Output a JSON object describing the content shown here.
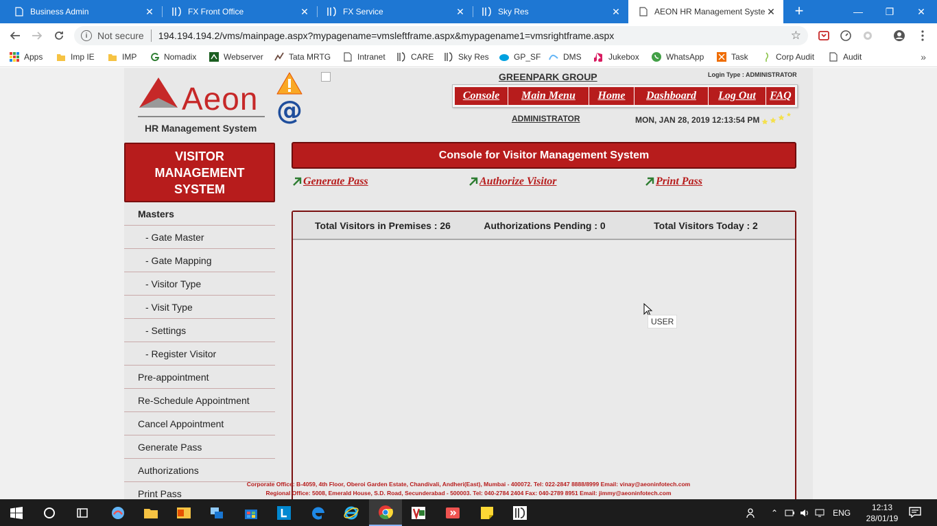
{
  "browser": {
    "tabs": [
      {
        "title": "Business Admin",
        "icon": "page-icon",
        "active": false
      },
      {
        "title": "FX Front Office",
        "icon": "ids-icon",
        "active": false
      },
      {
        "title": "FX Service",
        "icon": "ids-icon",
        "active": false
      },
      {
        "title": "Sky Res",
        "icon": "ids-icon",
        "active": false
      },
      {
        "title": "AEON HR Management System",
        "icon": "page-icon",
        "active": true
      }
    ],
    "close_glyph": "✕",
    "new_tab": "+",
    "window_controls": {
      "minimize": "—",
      "restore": "❐",
      "close": "✕"
    },
    "security_label": "Not secure",
    "url": "194.194.194.2/vms/mainpage.aspx?mypagename=vmsleftframe.aspx&mypagename1=vmsrightframe.aspx",
    "bookmarks": [
      {
        "label": "Apps",
        "icon": "apps-grid-icon"
      },
      {
        "label": "Imp IE",
        "icon": "folder-icon"
      },
      {
        "label": "IMP",
        "icon": "folder-icon"
      },
      {
        "label": "Nomadix",
        "icon": "nomadix-icon"
      },
      {
        "label": "Webserver",
        "icon": "webserver-icon"
      },
      {
        "label": "Tata MRTG",
        "icon": "mrtg-icon"
      },
      {
        "label": "Intranet",
        "icon": "page-icon"
      },
      {
        "label": "CARE",
        "icon": "ids-icon"
      },
      {
        "label": "Sky Res",
        "icon": "ids-icon"
      },
      {
        "label": "GP_SF",
        "icon": "salesforce-icon"
      },
      {
        "label": "DMS",
        "icon": "dms-icon"
      },
      {
        "label": "Jukebox",
        "icon": "jukebox-icon"
      },
      {
        "label": "WhatsApp",
        "icon": "whatsapp-icon"
      },
      {
        "label": "Task",
        "icon": "task-icon"
      },
      {
        "label": "Corp Audit",
        "icon": "corp-audit-icon"
      },
      {
        "label": "Audit",
        "icon": "page-icon"
      }
    ],
    "more_bookmarks": "»"
  },
  "app": {
    "logo_text": "Aeon",
    "logo_subtitle": "HR Management System",
    "company": "GREENPARK GROUP",
    "login_type": "Login Type : ADMINISTRATOR",
    "user": "ADMINISTRATOR",
    "datetime": "MON, JAN 28, 2019 12:13:54 PM",
    "menu": [
      "Console",
      "Main Menu",
      "Home",
      "Dashboard",
      "Log Out",
      "FAQ"
    ],
    "module_title_lines": [
      "VISITOR",
      "MANAGEMENT",
      "SYSTEM"
    ],
    "sidebar": [
      {
        "label": "Masters",
        "level": "head"
      },
      {
        "label": "- Gate Master",
        "level": "sub"
      },
      {
        "label": "- Gate Mapping",
        "level": "sub"
      },
      {
        "label": "- Visitor Type",
        "level": "sub"
      },
      {
        "label": "- Visit Type",
        "level": "sub"
      },
      {
        "label": "- Settings",
        "level": "sub"
      },
      {
        "label": "- Register Visitor",
        "level": "sub"
      },
      {
        "label": "Pre-appointment",
        "level": "top"
      },
      {
        "label": "Re-Schedule Appointment",
        "level": "top"
      },
      {
        "label": "Cancel Appointment",
        "level": "top"
      },
      {
        "label": "Generate Pass",
        "level": "top"
      },
      {
        "label": "Authorizations",
        "level": "top"
      },
      {
        "label": "Print Pass",
        "level": "top"
      }
    ],
    "console_title": "Console for Visitor Management System",
    "quick_links": [
      "Generate Pass",
      "Authorize Visitor",
      "Print Pass"
    ],
    "stats": [
      "Total Visitors in Premises : 26",
      "Authorizations Pending : 0",
      "Total Visitors Today : 2"
    ],
    "tooltip": "USER",
    "footer_lines": [
      "Corporate Office: B-4059, 4th Floor, Oberoi Garden Estate, Chandivali, Andheri(East), Mumbai - 400072. Tel: 022-2847 8888/8999 Email: vinay@aeoninfotech.com",
      "Regional Office: 5008, Emerald House, S.D. Road, Secunderabad - 500003. Tel: 040-2784 2404 Fax: 040-2789 8951 Email: jimmy@aeoninfotech.com"
    ]
  },
  "taskbar": {
    "apps": [
      "start-icon",
      "cortana-icon",
      "task-view-icon",
      "app-icon",
      "file-explorer-icon",
      "outlook-icon",
      "network-icon",
      "store-icon",
      "lync-icon",
      "edge-icon",
      "ie-icon",
      "chrome-icon",
      "visio-icon",
      "anydesk-icon",
      "sticky-notes-icon",
      "ids-icon"
    ],
    "language": "ENG",
    "time": "12:13",
    "date": "28/01/19"
  },
  "colors": {
    "accent_red": "#b71c1c",
    "chrome_blue": "#1e77d3",
    "taskbar": "#1c1c1c"
  }
}
